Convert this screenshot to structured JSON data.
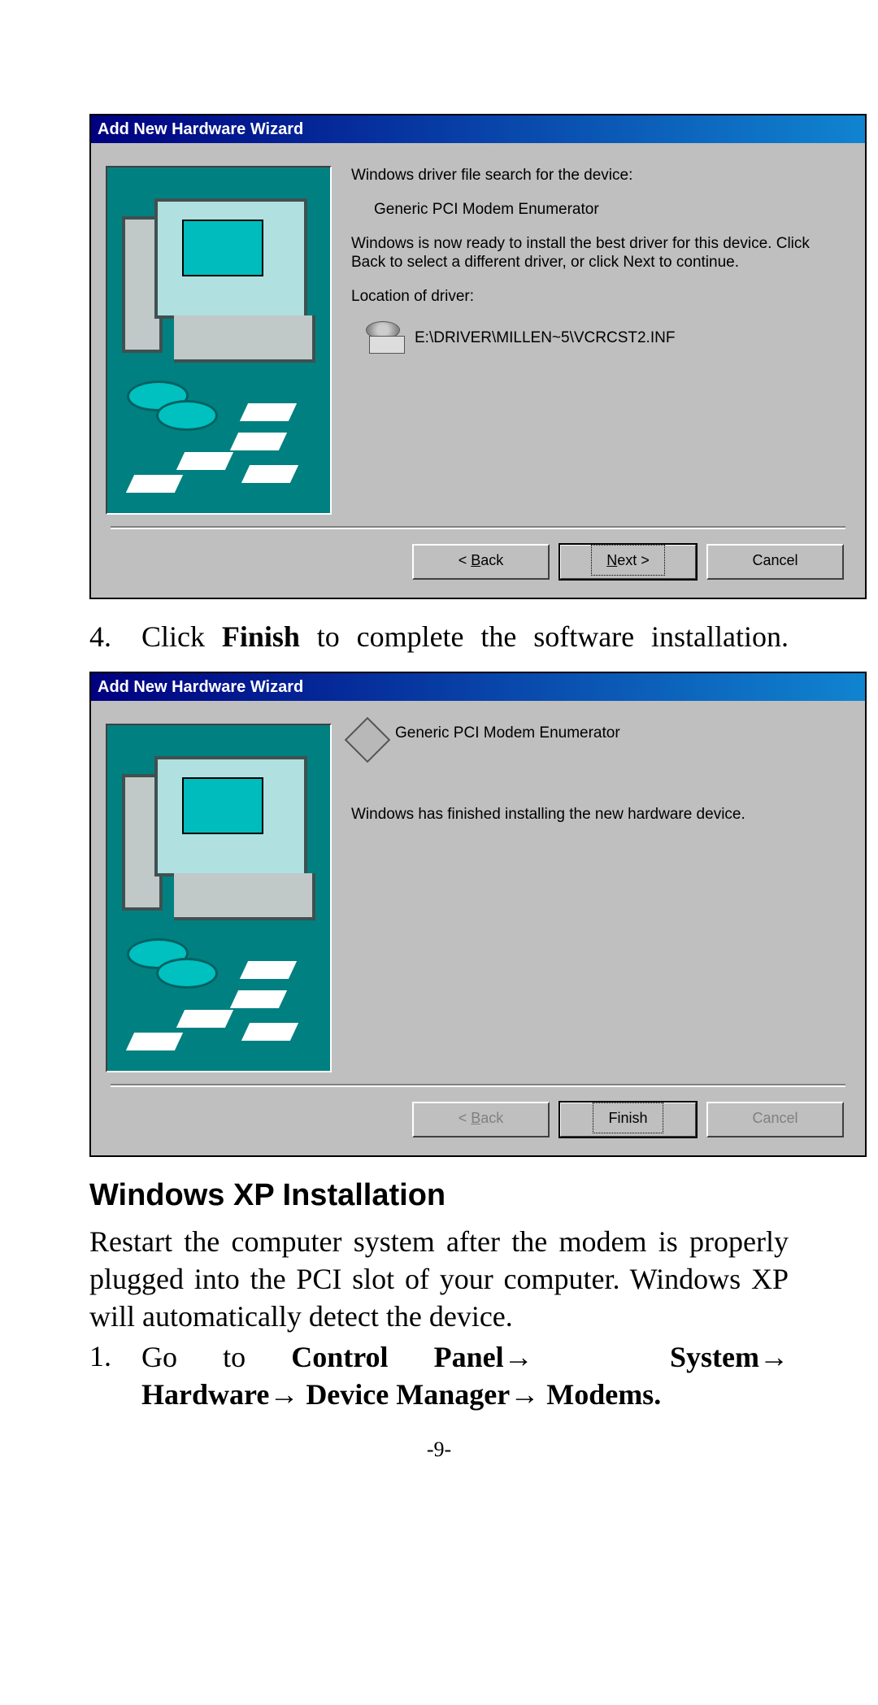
{
  "dialog1": {
    "title": "Add New Hardware Wizard",
    "line1": "Windows driver file search for the device:",
    "device": "Generic PCI Modem Enumerator",
    "line2": "Windows is now ready to install the best driver for this device. Click Back to select a different driver, or click Next to continue.",
    "loc_label": "Location of driver:",
    "loc_value": "E:\\DRIVER\\MILLEN~5\\VCRCST2.INF",
    "btn_back_prefix": "< ",
    "btn_back_u": "B",
    "btn_back_suffix": "ack",
    "btn_next_prefix": "",
    "btn_next_u": "N",
    "btn_next_suffix": "ext >",
    "btn_cancel": "Cancel"
  },
  "step4": {
    "num": "4.",
    "pre": "Click ",
    "bold": "Finish",
    "post": " to complete the software installation."
  },
  "dialog2": {
    "title": "Add New Hardware Wizard",
    "device": "Generic PCI Modem Enumerator",
    "done": "Windows has finished installing the new hardware device.",
    "btn_back_prefix": "< ",
    "btn_back_u": "B",
    "btn_back_suffix": "ack",
    "btn_finish": "Finish",
    "btn_cancel": "Cancel"
  },
  "heading_xp": "Windows XP Installation",
  "xp_intro": "Restart the computer system after the modem is properly plugged into the PCI slot of your computer. Windows XP will automatically detect the device.",
  "xp_step1": {
    "num": "1.",
    "go_to": "Go to ",
    "cp": "Control Panel",
    "sys": " System",
    "hw": "Hardware",
    "dm": " Device Manager",
    "modems": " Modems."
  },
  "arrow": "→",
  "page_number": "-9-"
}
